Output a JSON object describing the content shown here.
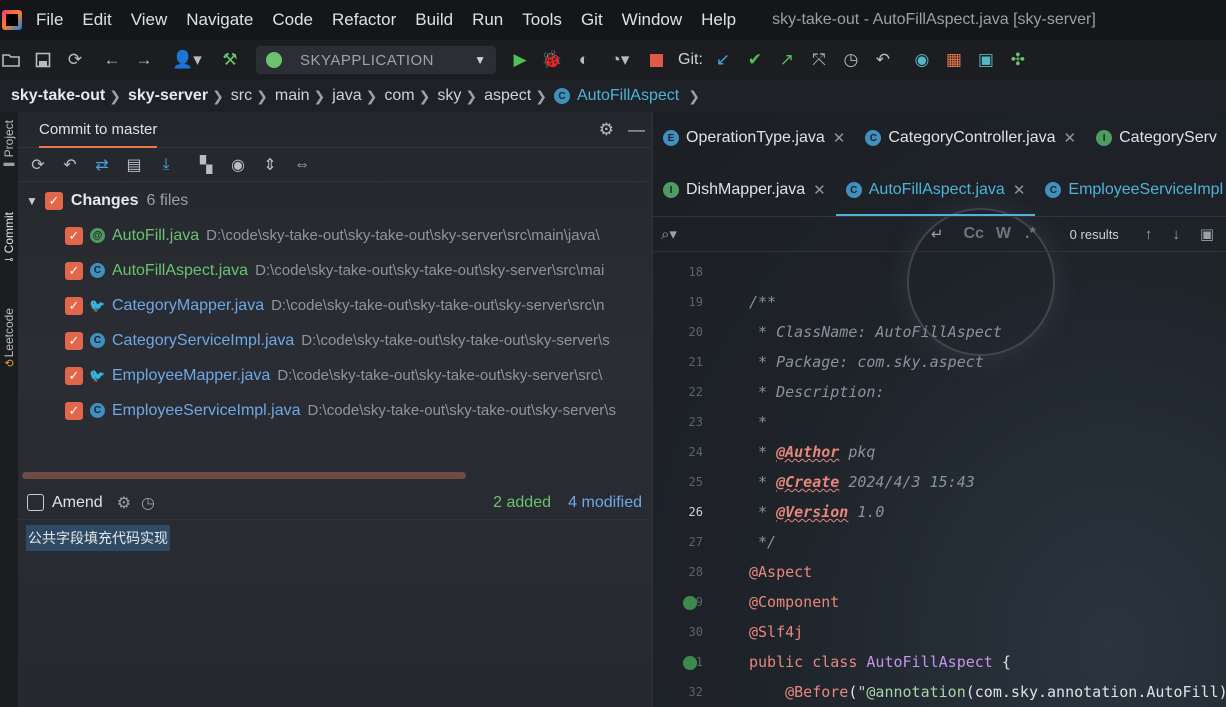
{
  "menu": {
    "items": [
      "File",
      "Edit",
      "View",
      "Navigate",
      "Code",
      "Refactor",
      "Build",
      "Run",
      "Tools",
      "Git",
      "Window",
      "Help"
    ],
    "window_title": "sky-take-out - AutoFillAspect.java [sky-server]"
  },
  "toolbar": {
    "run_config": "SKYAPPLICATION",
    "git_label": "Git:"
  },
  "breadcrumb": {
    "items": [
      "sky-take-out",
      "sky-server",
      "src",
      "main",
      "java",
      "com",
      "sky",
      "aspect"
    ],
    "current": "AutoFillAspect"
  },
  "toolstrip": {
    "tabs": [
      "Project",
      "Commit",
      "Leetcode"
    ]
  },
  "commit_panel": {
    "tab_title": "Commit to master",
    "changes_label": "Changes",
    "changes_count": "6 files",
    "files": [
      {
        "name": "AutoFill.java",
        "path": "D:\\code\\sky-take-out\\sky-take-out\\sky-server\\src\\main\\java\\",
        "icon": "annotation-icon",
        "status": "added"
      },
      {
        "name": "AutoFillAspect.java",
        "path": "D:\\code\\sky-take-out\\sky-take-out\\sky-server\\src\\mai",
        "icon": "class-icon",
        "status": "added"
      },
      {
        "name": "CategoryMapper.java",
        "path": "D:\\code\\sky-take-out\\sky-take-out\\sky-server\\src\\n",
        "icon": "mapper-icon",
        "status": "modified"
      },
      {
        "name": "CategoryServiceImpl.java",
        "path": "D:\\code\\sky-take-out\\sky-take-out\\sky-server\\s",
        "icon": "class-icon",
        "status": "modified"
      },
      {
        "name": "EmployeeMapper.java",
        "path": "D:\\code\\sky-take-out\\sky-take-out\\sky-server\\src\\",
        "icon": "mapper-icon",
        "status": "modified"
      },
      {
        "name": "EmployeeServiceImpl.java",
        "path": "D:\\code\\sky-take-out\\sky-take-out\\sky-server\\s",
        "icon": "class-icon",
        "status": "modified"
      }
    ],
    "amend_label": "Amend",
    "stat_added": "2 added",
    "stat_modified": "4 modified",
    "commit_message": "公共字段填充代码实现"
  },
  "editor": {
    "tabs_row1": [
      {
        "label": "OperationType.java",
        "icon": "E"
      },
      {
        "label": "CategoryController.java",
        "icon": "C"
      },
      {
        "label": "CategoryServ",
        "icon": "I"
      }
    ],
    "tabs_row2": [
      {
        "label": "DishMapper.java",
        "icon": "I"
      },
      {
        "label": "AutoFillAspect.java",
        "icon": "C"
      },
      {
        "label": "EmployeeServiceImpl",
        "icon": "C"
      }
    ],
    "search": {
      "match_case": "Cc",
      "words": "W",
      "regex": ".*",
      "results": "0 results"
    },
    "line_numbers": [
      "18",
      "19",
      "20",
      "21",
      "22",
      "23",
      "24",
      "25",
      "26",
      "27",
      "28",
      "29",
      "30",
      "31",
      "32"
    ],
    "current_line": "26",
    "code": {
      "l19": "/**",
      "l20": " * ClassName: AutoFillAspect",
      "l21": " * Package: com.sky.aspect",
      "l22": " * Description:",
      "l23": " *",
      "l24_pre": " * ",
      "l24_tag": "@Author",
      "l24_val": " pkq",
      "l25_pre": " * ",
      "l25_tag": "@Create",
      "l25_val": " 2024/4/3 15:43",
      "l26_pre": " * ",
      "l26_tag": "@Version",
      "l26_val": " 1.0",
      "l27": " */",
      "l28": "@Aspect",
      "l29": "@Component",
      "l30": "@Slf4j",
      "l31_kw": "public class ",
      "l31_cls": "AutoFillAspect",
      "l31_rest": " {",
      "l32_ann": "    @Before",
      "l32_p": "(",
      "l32_str": "\"@annotation",
      "l32_rest": "(com.sky.annotation.AutoFill)"
    }
  }
}
